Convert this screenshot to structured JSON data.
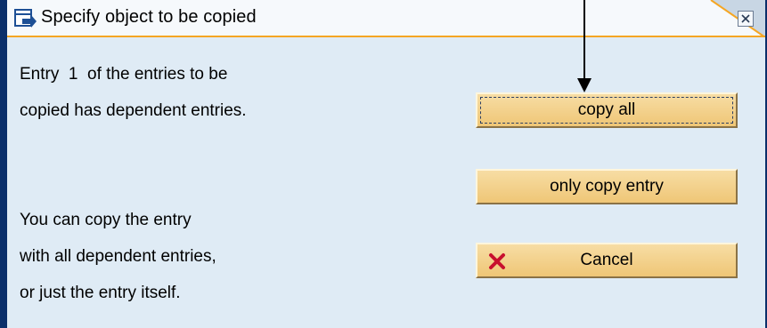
{
  "dialog": {
    "title": "Specify object to be copied",
    "title_icon": "dialog-arrow-icon",
    "close_icon": "close-icon",
    "message_lines_top": [
      "Entry  1  of the entries to be",
      "copied has dependent entries."
    ],
    "message_lines_bottom": [
      "You can copy the entry",
      "with all dependent entries,",
      "or just the entry itself."
    ]
  },
  "buttons": {
    "copy_all": "copy all",
    "only_copy_entry": "only copy entry",
    "cancel": "Cancel",
    "cancel_icon": "red-x-icon"
  },
  "colors": {
    "frame": "#0b2f6a",
    "body": "#dfebf5",
    "accent": "#f5a623",
    "button": "#efc676"
  }
}
